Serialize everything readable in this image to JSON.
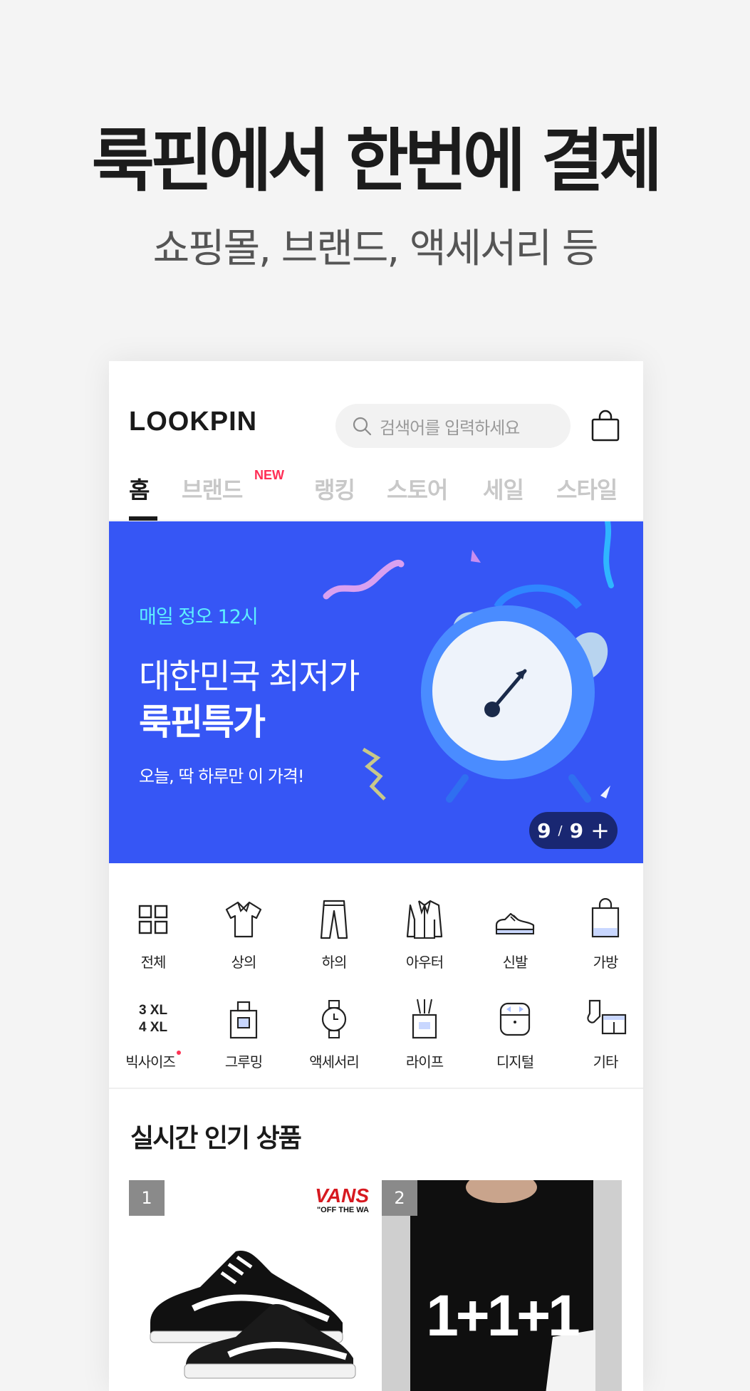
{
  "hero": {
    "title": "룩핀에서 한번에 결제",
    "subtitle": "쇼핑몰, 브랜드, 액세서리 등"
  },
  "app": {
    "logo": "LOOKPIN",
    "search_placeholder": "검색어를 입력하세요"
  },
  "tabs": [
    {
      "label": "홈",
      "active": true
    },
    {
      "label": "브랜드",
      "badge": "NEW"
    },
    {
      "label": "랭킹"
    },
    {
      "label": "스토어"
    },
    {
      "label": "세일"
    },
    {
      "label": "스타일"
    }
  ],
  "banner": {
    "eyebrow": "매일 정오 12시",
    "line1": "대한민국 최저가",
    "line2": "룩핀특가",
    "description": "오늘, 딱 하루만 이 가격!",
    "pager_current": "9",
    "pager_total": "9",
    "pager_plus": "+"
  },
  "categories": [
    {
      "label": "전체",
      "icon": "grid-icon"
    },
    {
      "label": "상의",
      "icon": "shirt-icon"
    },
    {
      "label": "하의",
      "icon": "pants-icon"
    },
    {
      "label": "아우터",
      "icon": "jacket-icon"
    },
    {
      "label": "신발",
      "icon": "sneaker-icon"
    },
    {
      "label": "가방",
      "icon": "bag-icon"
    },
    {
      "label": "빅사이즈",
      "icon": "bigsize-icon",
      "icon_text": [
        "3 XL",
        "4 XL"
      ]
    },
    {
      "label": "그루밍",
      "icon": "grooming-icon"
    },
    {
      "label": "액세서리",
      "icon": "watch-icon"
    },
    {
      "label": "라이프",
      "icon": "diffuser-icon"
    },
    {
      "label": "디지털",
      "icon": "earbuds-icon"
    },
    {
      "label": "기타",
      "icon": "socks-icon"
    }
  ],
  "section": {
    "title": "실시간 인기 상품"
  },
  "products": [
    {
      "rank": "1",
      "brand": "VANS",
      "brand_tagline": "\"OFF THE WA"
    },
    {
      "rank": "2",
      "overlay": "1+1+1"
    }
  ],
  "colors": {
    "banner_bg": "#3656f5",
    "eyebrow": "#5ef0ff",
    "new_badge": "#ff2d55"
  }
}
